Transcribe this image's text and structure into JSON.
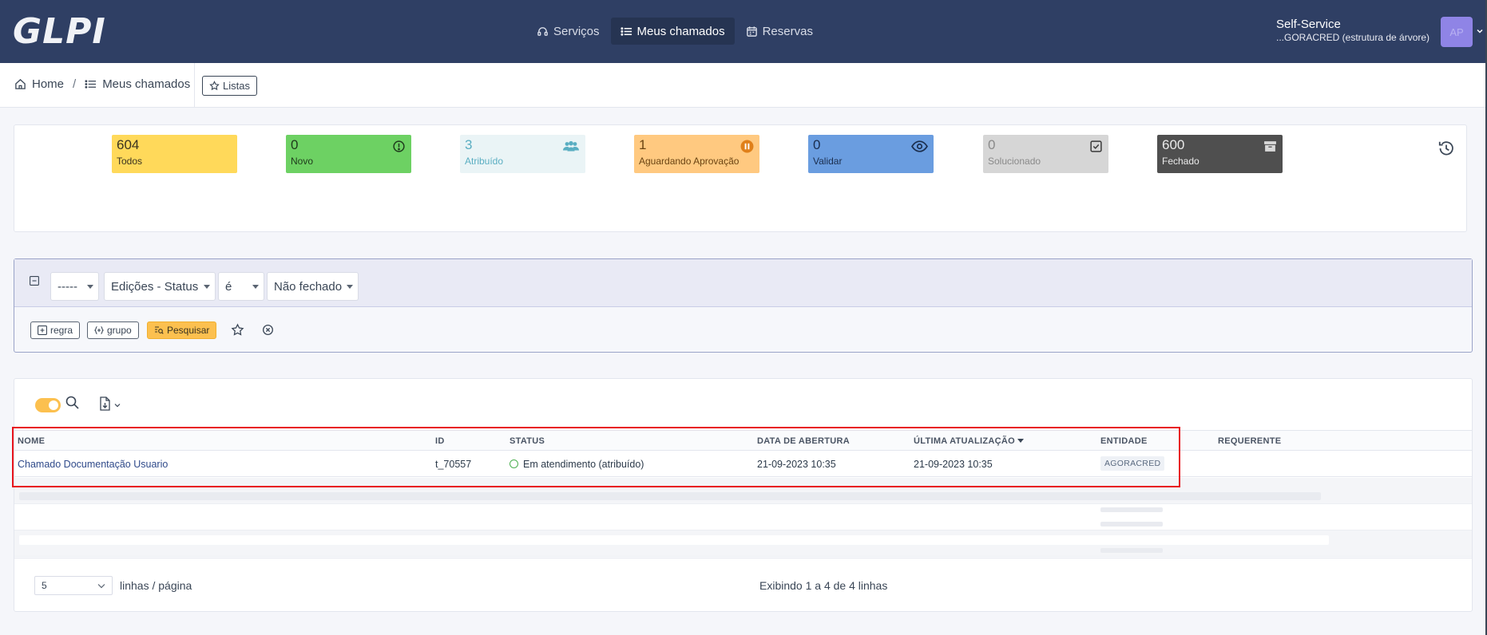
{
  "header": {
    "logo": "GLPI",
    "nav": [
      {
        "label": "Serviços",
        "icon": "headset-icon",
        "active": false
      },
      {
        "label": "Meus chamados",
        "icon": "list-icon",
        "active": true
      },
      {
        "label": "Reservas",
        "icon": "calendar-icon",
        "active": false
      }
    ],
    "profile_name": "Self-Service",
    "profile_entity": "...GORACRED (estrutura de árvore)",
    "avatar_initials": "AP"
  },
  "breadcrumb": {
    "home": "Home",
    "separator": "/",
    "current": "Meus chamados",
    "lists_button": "Listas"
  },
  "status_cards": [
    {
      "count": "604",
      "label": "Todos",
      "color": "#ffd95a",
      "icon": ""
    },
    {
      "count": "0",
      "label": "Novo",
      "color": "#6dd163",
      "icon": "new-circle-icon"
    },
    {
      "count": "3",
      "label": "Atribuído",
      "color": "#eaf4f6",
      "icon": "users-icon"
    },
    {
      "count": "1",
      "label": "Aguardando Aprovação",
      "color": "#ffc980",
      "icon": "pause-icon"
    },
    {
      "count": "0",
      "label": "Validar",
      "color": "#6a9de0",
      "icon": "eye-icon"
    },
    {
      "count": "0",
      "label": "Solucionado",
      "color": "#d6d6d6",
      "icon": "check-square-icon"
    },
    {
      "count": "600",
      "label": "Fechado",
      "color": "#4f4f4f",
      "icon": "archive-icon"
    }
  ],
  "search": {
    "criteria_field": "-----",
    "criteria_item": "Edições - Status",
    "operator": "é",
    "value": "Não fechado",
    "rule_button": "regra",
    "group_button": "grupo",
    "search_button": "Pesquisar"
  },
  "table": {
    "columns": [
      "NOME",
      "ID",
      "STATUS",
      "DATA DE ABERTURA",
      "ÚLTIMA ATUALIZAÇÃO",
      "ENTIDADE",
      "REQUERENTE"
    ],
    "rows": [
      {
        "name": "Chamado Documentação Usuario",
        "id": "t_70557",
        "status": "Em atendimento (atribuído)",
        "opened": "21-09-2023 10:35",
        "updated": "21-09-2023 10:35",
        "entity": "AGORACRED",
        "requester": ""
      }
    ]
  },
  "pagination": {
    "per_page": "5",
    "per_page_label": "linhas / página",
    "showing": "Exibindo 1 a 4 de 4 linhas"
  }
}
